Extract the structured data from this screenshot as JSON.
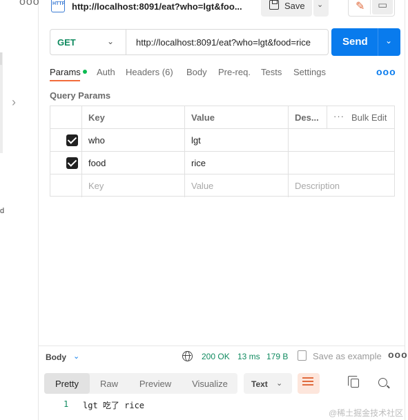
{
  "sidebar": {
    "more_label": "ooo",
    "fragment": "d"
  },
  "tab": {
    "icon_text": "HTTP",
    "title": "http://localhost:8091/eat?who=lgt&foo..."
  },
  "toolbar": {
    "save_label": "Save"
  },
  "request": {
    "method": "GET",
    "url": "http://localhost:8091/eat?who=lgt&food=rice",
    "send_label": "Send"
  },
  "request_tabs": [
    {
      "label": "Params",
      "active": true
    },
    {
      "label": "Auth"
    },
    {
      "label": "Headers",
      "count": "(6)"
    },
    {
      "label": "Body"
    },
    {
      "label": "Pre-req."
    },
    {
      "label": "Tests"
    },
    {
      "label": "Settings"
    }
  ],
  "params": {
    "section_title": "Query Params",
    "headers": {
      "key": "Key",
      "value": "Value",
      "description": "Des...",
      "bulk_edit": "Bulk Edit"
    },
    "rows": [
      {
        "checked": true,
        "key": "who",
        "value": "lgt"
      },
      {
        "checked": true,
        "key": "food",
        "value": "rice"
      }
    ],
    "placeholders": {
      "key": "Key",
      "value": "Value",
      "description": "Description"
    }
  },
  "response": {
    "body_label": "Body",
    "status": "200 OK",
    "time": "13 ms",
    "size": "179 B",
    "save_example": "Save as example",
    "view_tabs": [
      "Pretty",
      "Raw",
      "Preview",
      "Visualize"
    ],
    "format": "Text",
    "line_number": "1",
    "line_text": "lgt 吃了 rice"
  },
  "watermark": "@稀土掘金技术社区",
  "colors": {
    "accent": "#f26b3a",
    "send": "#097bed",
    "method": "#0f8a5f",
    "status": "#0f8a5f"
  }
}
